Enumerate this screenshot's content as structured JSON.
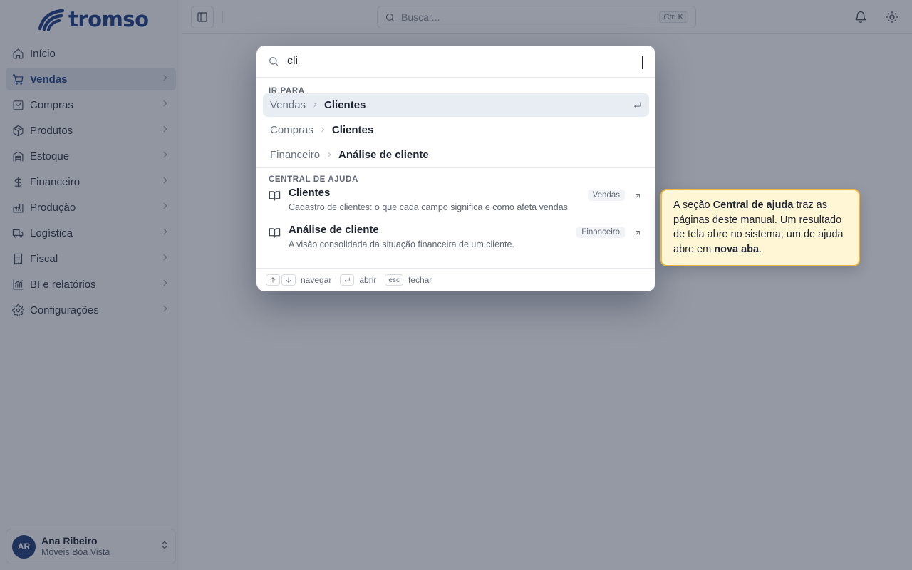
{
  "app": {
    "logo_text": "tromso",
    "brand_color": "#1d3f86"
  },
  "sidebar": {
    "items": [
      {
        "label": "Início",
        "icon": "home-icon"
      },
      {
        "label": "Vendas",
        "icon": "cart-icon",
        "active": true
      },
      {
        "label": "Compras",
        "icon": "shopping-bag-icon"
      },
      {
        "label": "Produtos",
        "icon": "box-icon"
      },
      {
        "label": "Estoque",
        "icon": "warehouse-icon"
      },
      {
        "label": "Financeiro",
        "icon": "dollar-icon"
      },
      {
        "label": "Produção",
        "icon": "factory-icon"
      },
      {
        "label": "Logística",
        "icon": "truck-icon"
      },
      {
        "label": "Fiscal",
        "icon": "receipt-icon"
      },
      {
        "label": "BI e relatórios",
        "icon": "chart-icon"
      },
      {
        "label": "Configurações",
        "icon": "gear-icon"
      }
    ],
    "user": {
      "initials": "AR",
      "name": "Ana Ribeiro",
      "company": "Móveis Boa Vista"
    }
  },
  "topbar": {
    "search_placeholder": "Buscar...",
    "search_shortcut": "Ctrl K"
  },
  "palette": {
    "query": "cli",
    "goto_group_label": "Ir para",
    "goto_items": [
      {
        "parent": "Vendas",
        "child": "Clientes",
        "selected": true
      },
      {
        "parent": "Compras",
        "child": "Clientes"
      },
      {
        "parent": "Financeiro",
        "child": "Análise de cliente"
      }
    ],
    "help_group_label": "Central de ajuda",
    "help_items": [
      {
        "title": "Clientes",
        "description": "Cadastro de clientes: o que cada campo significa e como afeta vendas",
        "badge": "Vendas"
      },
      {
        "title": "Análise de cliente",
        "description": "A visão consolidada da situação financeira de um cliente.",
        "badge": "Financeiro"
      }
    ],
    "footer": {
      "navigate": "navegar",
      "open": "abrir",
      "esc_key": "esc",
      "close": "fechar"
    }
  },
  "tooltip": {
    "p1": "A seção ",
    "b1": "Central de ajuda",
    "p2": " traz as páginas deste manual. Um resultado de tela abre no sistema; um de ajuda abre em ",
    "b2": "nova aba",
    "p3": "."
  }
}
